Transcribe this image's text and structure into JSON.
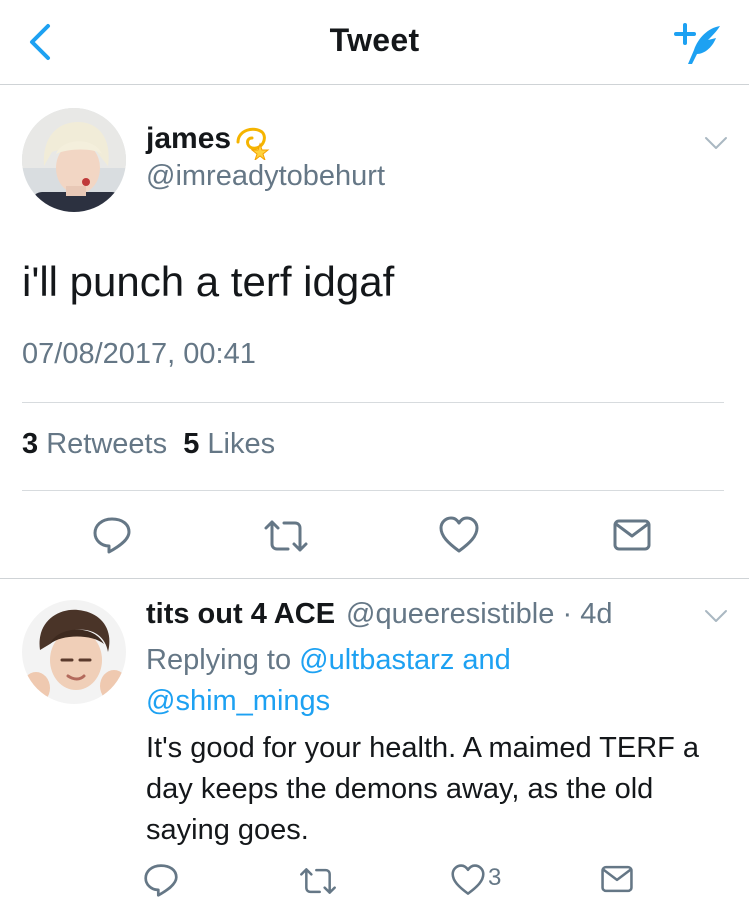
{
  "header": {
    "title": "Tweet"
  },
  "tweet": {
    "display_name": "james",
    "name_emoji": "dizzy-emoji",
    "handle": "@imreadytobehurt",
    "text": "i'll punch a terf idgaf",
    "timestamp": "07/08/2017, 00:41",
    "retweets_count": "3",
    "retweets_label": "Retweets",
    "likes_count": "5",
    "likes_label": "Likes"
  },
  "reply": {
    "display_name": "tits out 4 ACE",
    "handle": "@queeresistible",
    "separator": "·",
    "time_ago": "4d",
    "replying_prefix": "Replying to",
    "mention_1": "@ultbastarz",
    "conjunction": "and",
    "mention_2": "@shim_mings",
    "text": "It's good for your health. A maimed TERF a day keeps the demons away, as the old saying goes.",
    "likes_count": "3"
  },
  "icons": {
    "back": "chevron-left-icon",
    "compose": "compose-tweet-icon",
    "reply": "reply-icon",
    "retweet": "retweet-icon",
    "like": "heart-icon",
    "dm": "envelope-icon",
    "caret": "chevron-down-icon"
  },
  "colors": {
    "accent": "#1da1f2",
    "secondary_text": "#657786",
    "primary_text": "#14171a",
    "divider": "#d7dbde"
  }
}
